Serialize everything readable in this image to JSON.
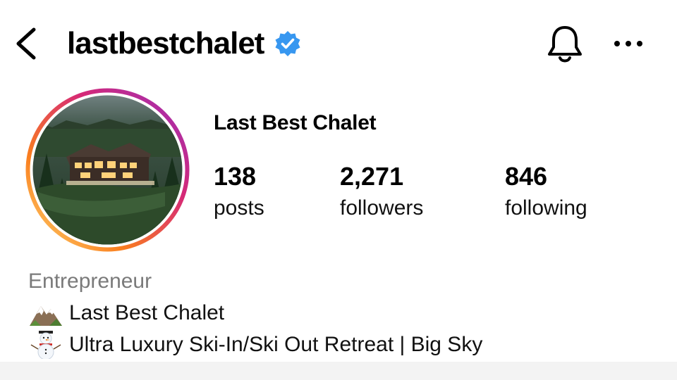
{
  "header": {
    "username": "lastbestchalet",
    "back_icon": "chevron-left-icon",
    "verified_icon": "verified-badge-icon",
    "bell_icon": "bell-icon",
    "more_icon": "more-horizontal-icon"
  },
  "profile": {
    "display_name": "Last Best Chalet",
    "avatar_icon": "chalet-photo-avatar"
  },
  "stats": [
    {
      "value": "138",
      "label": "posts"
    },
    {
      "value": "2,271",
      "label": "followers"
    },
    {
      "value": "846",
      "label": "following"
    }
  ],
  "bio": {
    "category": "Entrepreneur",
    "lines": [
      {
        "icon": "mountain-emoji",
        "text": "Last Best Chalet"
      },
      {
        "icon": "snowman-emoji",
        "text": "Ultra Luxury Ski-In/Ski Out Retreat | Big Sky"
      }
    ]
  },
  "colors": {
    "verified_blue": "#3797f0",
    "story_ring": [
      "#feda75",
      "#fa7e1e",
      "#d62976",
      "#962fbf"
    ],
    "category_gray": "#7a7a7a"
  }
}
